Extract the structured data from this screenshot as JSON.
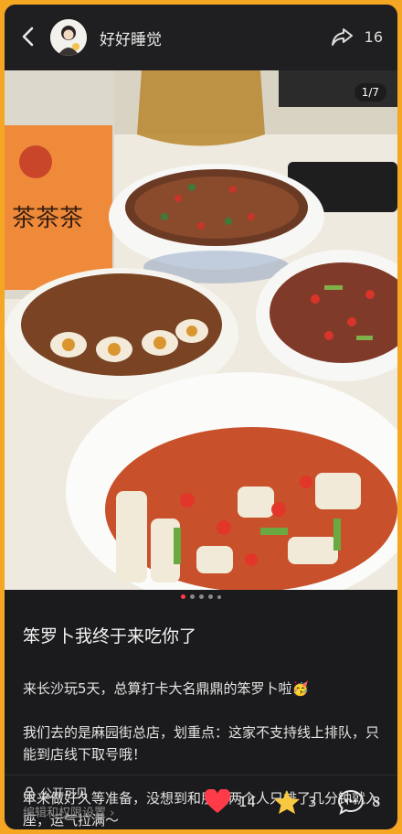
{
  "header": {
    "username": "好好睡觉",
    "share_count": "16"
  },
  "photo": {
    "pager": "1/7",
    "bottle_brand": "茶茶茶",
    "dots": 5,
    "active_dot": 0
  },
  "post": {
    "title": "笨罗卜我终于来吃你了",
    "body_line1": "来长沙玩5天，总算打卡大名鼎鼎的笨罗卜啦🥳",
    "body_line2": "我们去的是麻园街总店，划重点：这家不支持线上排队，只能到店线下取号哦！",
    "body_line3": "本来做好久等准备，没想到和朋友两个人只排了几分钟就入座，运气拉满～"
  },
  "footer": {
    "privacy_label": "公开可见",
    "permission_link": "编辑和权限设置 ›",
    "likes": "14",
    "favorites": "3",
    "comments": "8"
  },
  "colors": {
    "frame_border": "#f5a623",
    "like": "#ff3b4a",
    "favorite": "#f7c940"
  }
}
